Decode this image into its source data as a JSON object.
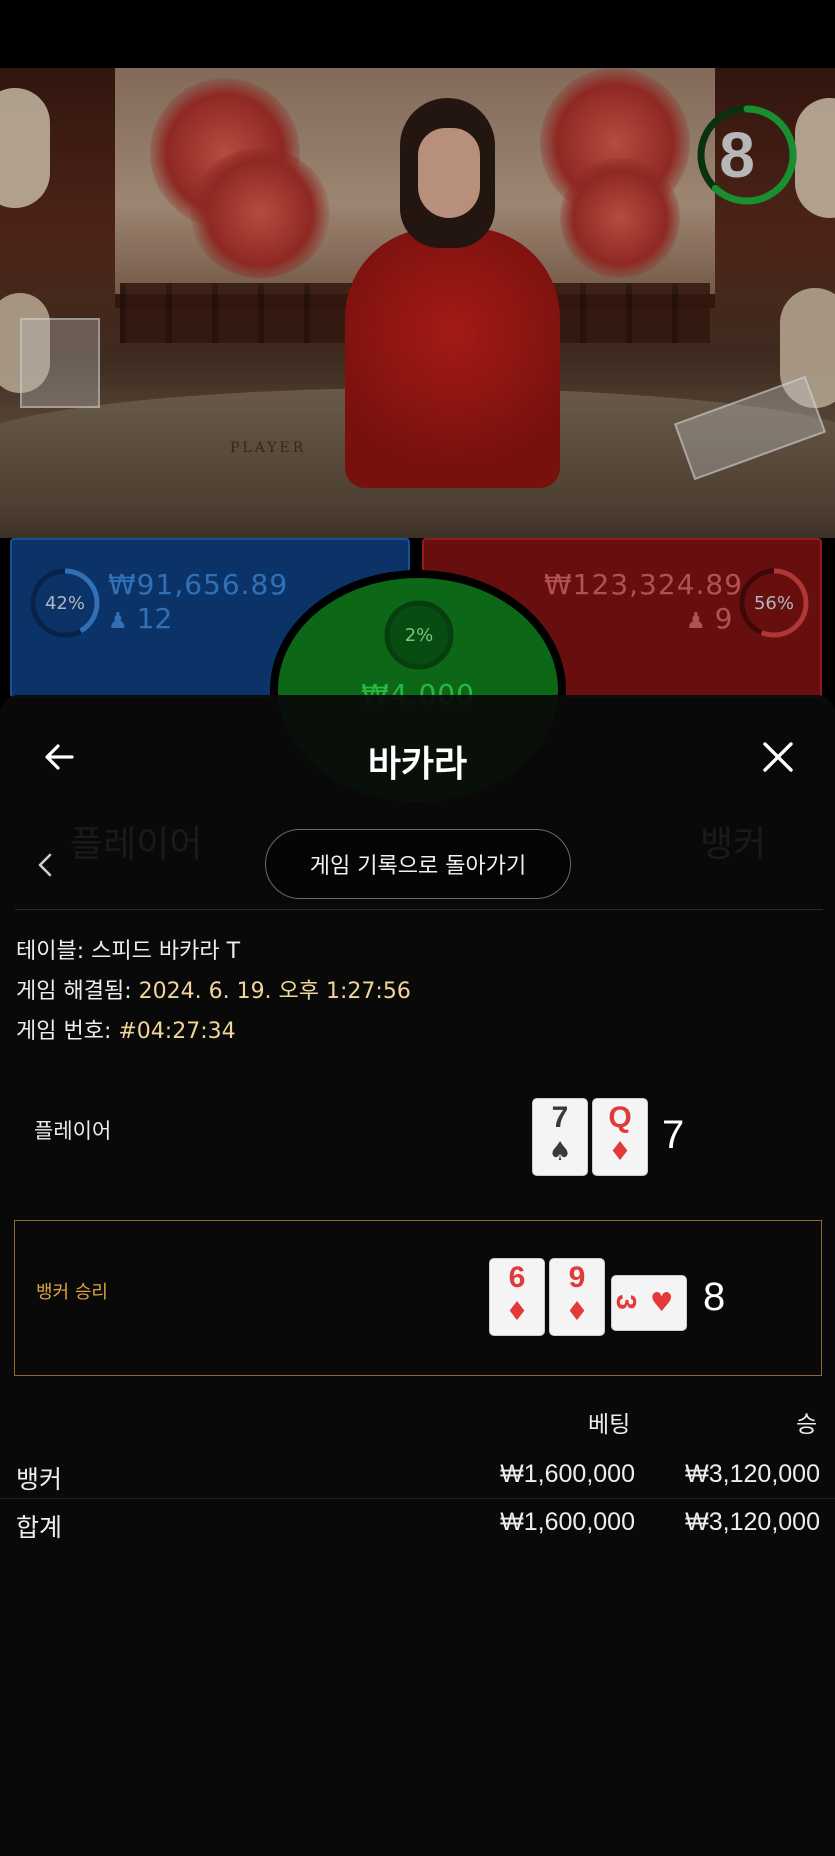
{
  "timer": {
    "value": "8",
    "progress": 0.62,
    "color": "#1fa83a"
  },
  "bets": {
    "player": {
      "percent": "42%",
      "amount": "₩91,656.89",
      "players": "12",
      "color": "#0e3d7a"
    },
    "tie": {
      "percent": "2%",
      "amount": "₩4,000",
      "color": "#0f7a1c"
    },
    "banker": {
      "percent": "56%",
      "amount": "₩123,324.89",
      "players": "9",
      "color": "#7a1212"
    }
  },
  "video": {
    "table_label": "PLAYER"
  },
  "modal": {
    "title": "바카라",
    "back_button_label": "게임 기록으로 돌아가기",
    "info": {
      "table_label": "테이블:",
      "table_value": "스피드 바카라 T",
      "resolved_label": "게임 해결됨:",
      "resolved_value": "2024. 6. 19. 오후 1:27:56",
      "number_label": "게임 번호:",
      "number_value": "#04:27:34"
    },
    "player_row": {
      "label": "플레이어",
      "cards": [
        {
          "rank": "7",
          "suit": "♠",
          "color": "black"
        },
        {
          "rank": "Q",
          "suit": "♦",
          "color": "red"
        }
      ],
      "score": "7"
    },
    "banker_row": {
      "label": "뱅커 승리",
      "cards": [
        {
          "rank": "6",
          "suit": "♦",
          "color": "red"
        },
        {
          "rank": "9",
          "suit": "♦",
          "color": "red"
        },
        {
          "rank": "3",
          "suit": "♥",
          "color": "red"
        }
      ],
      "score": "8"
    },
    "table": {
      "col_bet": "베팅",
      "col_win": "승",
      "rows": [
        {
          "label": "뱅커",
          "bet": "₩1,600,000",
          "win": "₩3,120,000"
        },
        {
          "label": "합계",
          "bet": "₩1,600,000",
          "win": "₩3,120,000"
        }
      ]
    }
  }
}
